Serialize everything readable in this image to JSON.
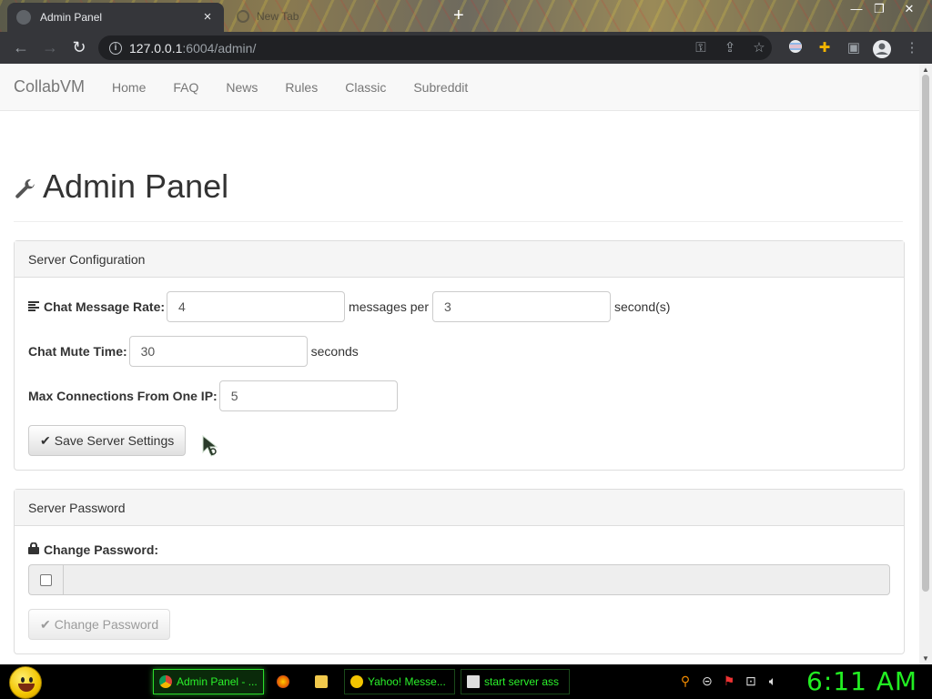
{
  "browser": {
    "active_tab_title": "Admin Panel",
    "inactive_tab_title": "New Tab",
    "url_host": "127.0.0.1",
    "url_rest": ":6004/admin/"
  },
  "navbar": {
    "brand": "CollabVM",
    "links": [
      "Home",
      "FAQ",
      "News",
      "Rules",
      "Classic",
      "Subreddit"
    ]
  },
  "page": {
    "title": "Admin Panel"
  },
  "server_config": {
    "heading": "Server Configuration",
    "chat_rate_label": "Chat Message Rate:",
    "chat_rate_messages": "4",
    "messages_per_text": "messages per",
    "chat_rate_seconds": "3",
    "seconds_paren_text": "second(s)",
    "mute_label": "Chat Mute Time:",
    "mute_value": "30",
    "seconds_text": "seconds",
    "max_conn_label": "Max Connections From One IP:",
    "max_conn_value": "5",
    "save_button": "Save Server Settings"
  },
  "server_password": {
    "heading": "Server Password",
    "change_label": "Change Password:",
    "change_button": "Change Password"
  },
  "taskbar": {
    "tasks": [
      "Admin Panel - ...",
      "Yahoo! Messe...",
      "start server ass"
    ],
    "clock": "6:11 AM"
  }
}
